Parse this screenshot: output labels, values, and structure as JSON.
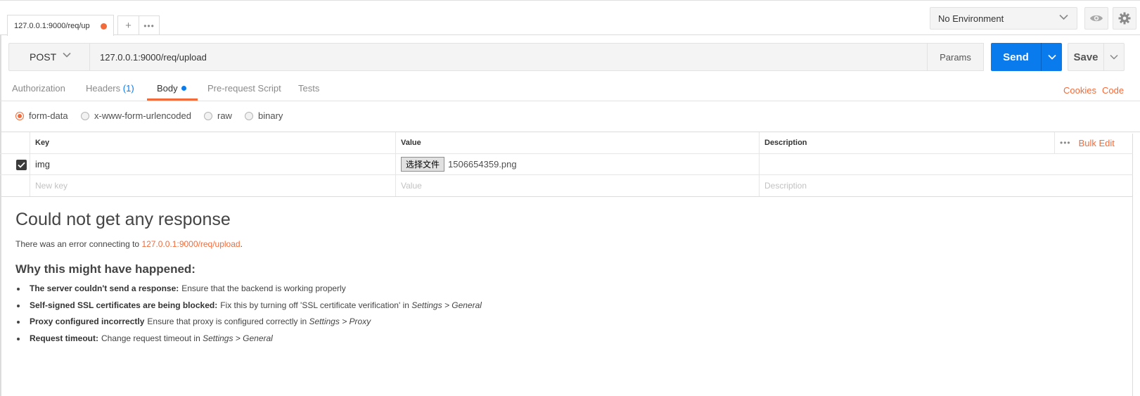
{
  "tab": {
    "title": "127.0.0.1:9000/req/up",
    "add_label": "+",
    "more_label": "•••"
  },
  "environment": {
    "selected": "No Environment"
  },
  "request": {
    "method": "POST",
    "url": "127.0.0.1:9000/req/upload",
    "params_label": "Params",
    "send_label": "Send",
    "save_label": "Save"
  },
  "subtabs": {
    "authorization": "Authorization",
    "headers": "Headers",
    "headers_count": "(1)",
    "body": "Body",
    "prerequest": "Pre-request Script",
    "tests": "Tests",
    "cookies": "Cookies",
    "code": "Code"
  },
  "body_types": [
    "form-data",
    "x-www-form-urlencoded",
    "raw",
    "binary"
  ],
  "table": {
    "headers": {
      "key": "Key",
      "value": "Value",
      "description": "Description",
      "bulk_edit": "Bulk Edit",
      "more": "•••"
    },
    "row": {
      "key": "img",
      "file_button": "选择文件",
      "file_name": "1506654359.png"
    },
    "placeholders": {
      "key": "New key",
      "value": "Value",
      "description": "Description"
    }
  },
  "response": {
    "title": "Could not get any response",
    "error_prefix": "There was an error connecting to ",
    "error_url": "127.0.0.1:9000/req/upload",
    "error_suffix": ".",
    "why_title": "Why this might have happened:",
    "reasons": [
      {
        "bold": "The server couldn't send a response:",
        "text": "Ensure that the backend is working properly",
        "italic": ""
      },
      {
        "bold": "Self-signed SSL certificates are being blocked:",
        "text": "Fix this by turning off 'SSL certificate verification' in ",
        "italic": "Settings > General"
      },
      {
        "bold": "Proxy configured incorrectly",
        "text": "Ensure that proxy is configured correctly in ",
        "italic": "Settings > Proxy"
      },
      {
        "bold": "Request timeout:",
        "text": "Change request timeout in ",
        "italic": "Settings > General"
      }
    ]
  },
  "colors": {
    "accent": "#f26b3a",
    "primary": "#097bed",
    "text": "#505050"
  }
}
